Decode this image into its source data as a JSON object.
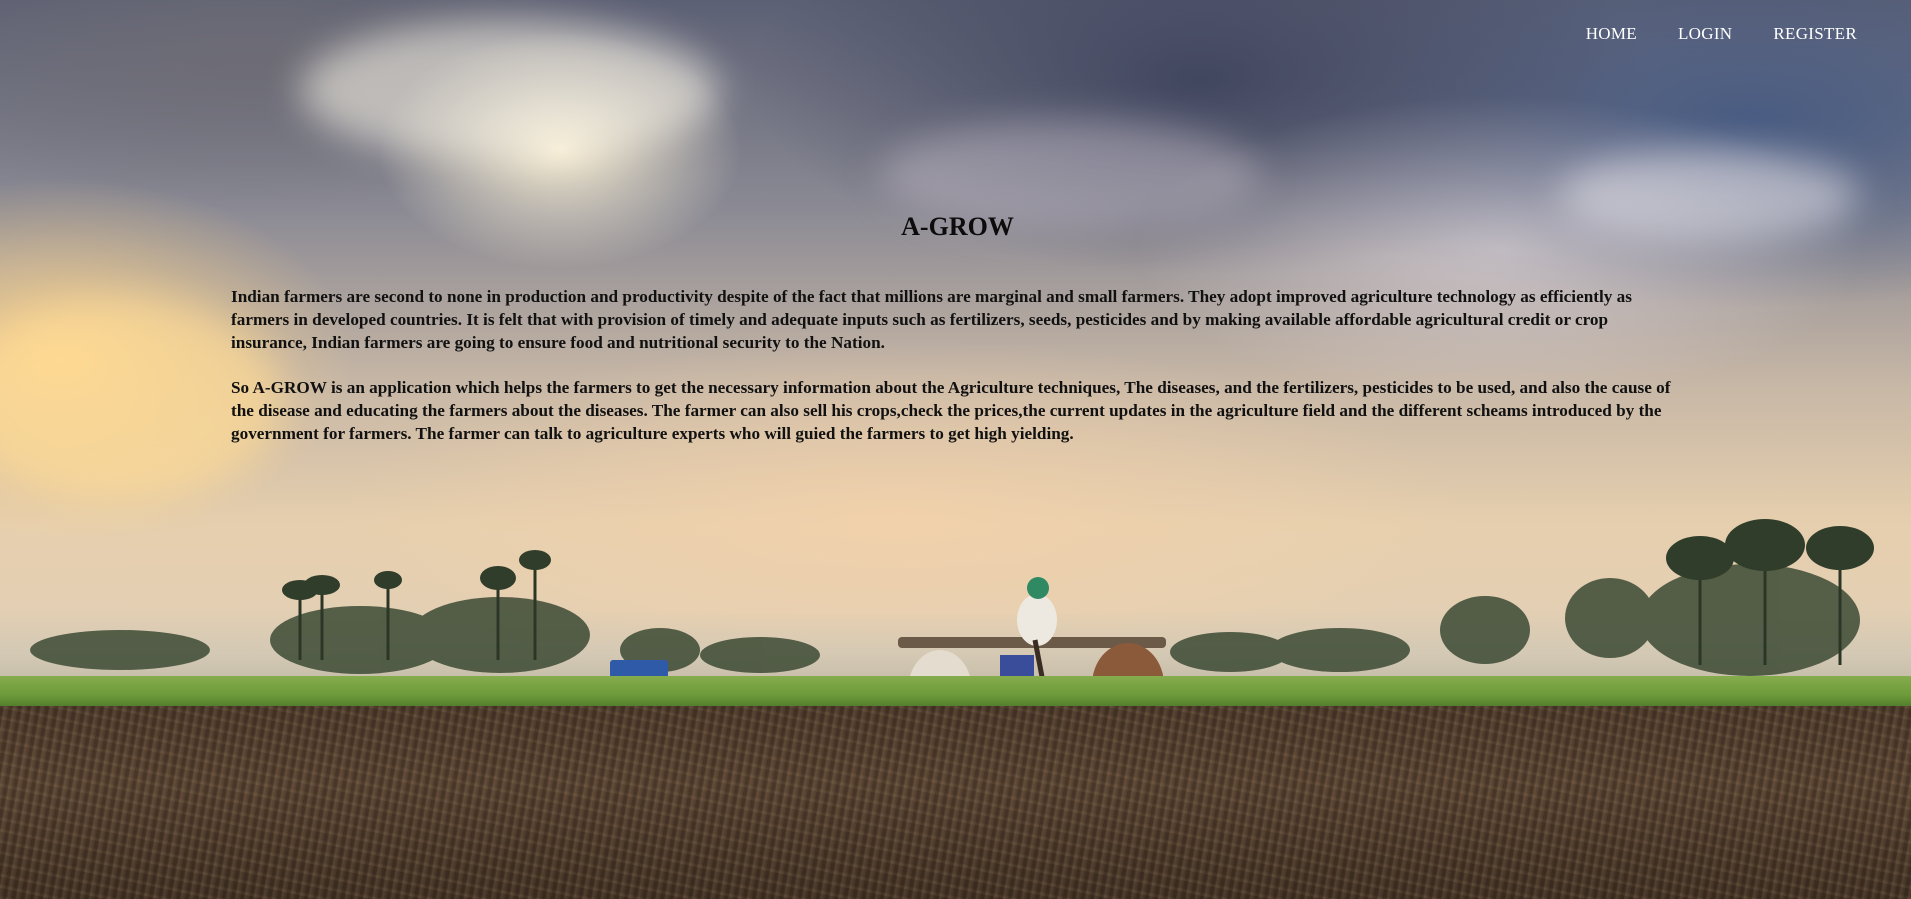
{
  "nav": {
    "items": [
      {
        "label": "HOME"
      },
      {
        "label": "LOGIN"
      },
      {
        "label": "REGISTER"
      }
    ]
  },
  "hero": {
    "title": "A-GROW",
    "paragraphs": [
      "Indian farmers are second to none in production and productivity despite of the fact that millions are marginal and small farmers. They adopt improved agriculture technology as efficiently as farmers in developed countries. It is felt that with provision of timely and adequate inputs such as fertilizers, seeds, pesticides and by making available affordable agricultural credit or crop insurance, Indian farmers are going to ensure food and nutritional security to the Nation.",
      "So A-GROW is an application which helps the farmers to get the necessary information about the Agriculture techniques, The diseases, and the fertilizers, pesticides to be used, and also the cause of the disease and educating the farmers about the diseases. The farmer can also sell his crops,check the prices,the current updates in the agriculture field and the different scheams introduced by the government for farmers. The farmer can talk to agriculture experts who will guied the farmers to get high yielding."
    ]
  },
  "colors": {
    "nav_text": "#ffffff",
    "body_text": "#111111",
    "title_text": "#0c0c0c"
  },
  "background": {
    "icon": "farm-landscape-photo"
  }
}
